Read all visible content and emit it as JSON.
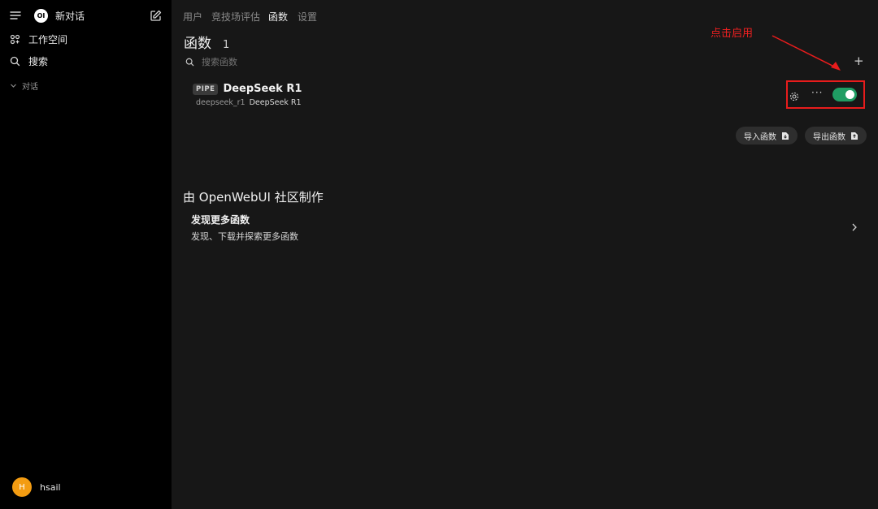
{
  "sidebar": {
    "new_chat_label": "新对话",
    "logo_text": "OI",
    "workspace_label": "工作空间",
    "search_label": "搜索",
    "chats_section_label": "对话",
    "user": {
      "initial": "H",
      "name": "hsail"
    }
  },
  "tabs": [
    {
      "label": "用户"
    },
    {
      "label": "竞技场评估"
    },
    {
      "label": "函数"
    },
    {
      "label": "设置"
    }
  ],
  "page": {
    "title": "函数",
    "count": "1",
    "search_placeholder": "搜索函数",
    "add_symbol": "+"
  },
  "functions": [
    {
      "badge": "PIPE",
      "name": "DeepSeek R1",
      "id": "deepseek_r1",
      "description": "DeepSeek R1",
      "enabled": true
    }
  ],
  "actions": {
    "import_label": "导入函数",
    "export_label": "导出函数"
  },
  "community": {
    "heading": "由 OpenWebUI 社区制作",
    "discover_title": "发现更多函数",
    "discover_subtitle": "发现、下载并探索更多函数"
  },
  "annotation": {
    "text": "点击启用",
    "color": "#e81c1c"
  },
  "colors": {
    "toggle_on": "#1f9d63",
    "avatar": "#f39c12"
  }
}
